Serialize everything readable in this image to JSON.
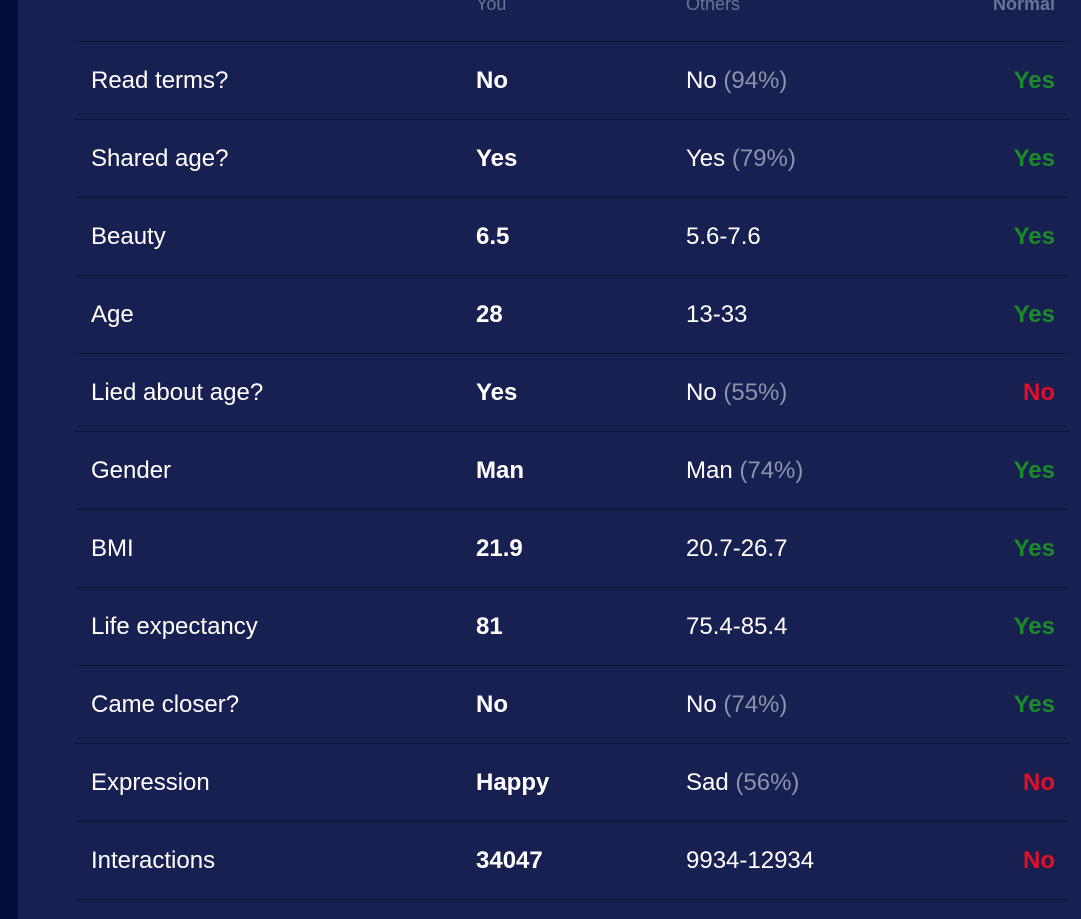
{
  "header": {
    "you": "You",
    "others": "Others",
    "normal": "Normal"
  },
  "rows": [
    {
      "label": "Read terms?",
      "you": "No",
      "others": "No",
      "others_pct": "(94%)",
      "normal": "Yes",
      "normal_color": "#1a8a2a"
    },
    {
      "label": "Shared age?",
      "you": "Yes",
      "others": "Yes",
      "others_pct": "(79%)",
      "normal": "Yes",
      "normal_color": "#1a8a2a"
    },
    {
      "label": "Beauty",
      "you": "6.5",
      "others": "5.6-7.6",
      "others_pct": "",
      "normal": "Yes",
      "normal_color": "#1a8a2a"
    },
    {
      "label": "Age",
      "you": "28",
      "others": "13-33",
      "others_pct": "",
      "normal": "Yes",
      "normal_color": "#1a8a2a"
    },
    {
      "label": "Lied about age?",
      "you": "Yes",
      "others": "No",
      "others_pct": "(55%)",
      "normal": "No",
      "normal_color": "#e0102a"
    },
    {
      "label": "Gender",
      "you": "Man",
      "others": "Man",
      "others_pct": "(74%)",
      "normal": "Yes",
      "normal_color": "#1a8a2a"
    },
    {
      "label": "BMI",
      "you": "21.9",
      "others": "20.7-26.7",
      "others_pct": "",
      "normal": "Yes",
      "normal_color": "#1a8a2a"
    },
    {
      "label": "Life expectancy",
      "you": "81",
      "others": "75.4-85.4",
      "others_pct": "",
      "normal": "Yes",
      "normal_color": "#1a8a2a"
    },
    {
      "label": "Came closer?",
      "you": "No",
      "others": "No",
      "others_pct": "(74%)",
      "normal": "Yes",
      "normal_color": "#1a8a2a"
    },
    {
      "label": "Expression",
      "you": "Happy",
      "others": "Sad",
      "others_pct": "(56%)",
      "normal": "No",
      "normal_color": "#e0102a"
    },
    {
      "label": "Interactions",
      "you": "34047",
      "others": "9934-12934",
      "others_pct": "",
      "normal": "No",
      "normal_color": "#e0102a"
    }
  ]
}
